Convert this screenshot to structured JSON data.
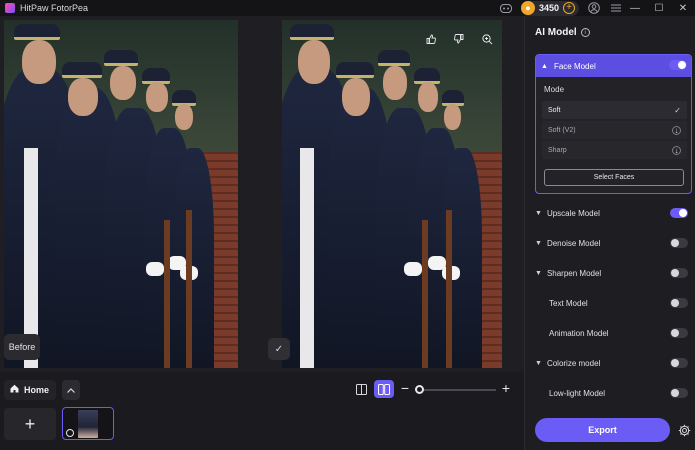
{
  "app": {
    "title": "HitPaw FotorPea",
    "coins": "3450"
  },
  "titlebar": {
    "discord_icon": "game-controller-icon",
    "coin_icon": "coin-icon",
    "plus_icon": "plus-icon",
    "account_icon": "user-circle-icon",
    "menu_icon": "hamburger-icon",
    "minimize": "—",
    "maximize": "☐",
    "close": "✕"
  },
  "canvas": {
    "before_label": "Before",
    "overlay_icons": [
      "thumbs-up-icon",
      "thumbs-down-icon",
      "zoom-in-icon",
      "crop-icon"
    ],
    "check_icon": "✓"
  },
  "bottom": {
    "home_label": "Home",
    "collapse_icon": "^",
    "add_icon": "+",
    "zoom_minus": "−",
    "zoom_plus": "+",
    "zoom_level": 0.0
  },
  "panel": {
    "title": "AI Model",
    "face_model": {
      "label": "Face Model",
      "enabled": true,
      "mode_label": "Mode",
      "modes": [
        {
          "label": "Soft",
          "selected": true
        },
        {
          "label": "Soft (V2)",
          "selected": false
        },
        {
          "label": "Sharp",
          "selected": false
        }
      ],
      "select_faces_label": "Select Faces"
    },
    "models": [
      {
        "label": "Upscale Model",
        "enabled": true,
        "caret": true
      },
      {
        "label": "Denoise Model",
        "enabled": false,
        "caret": true
      },
      {
        "label": "Sharpen Model",
        "enabled": false,
        "caret": true
      },
      {
        "label": "Text Model",
        "enabled": false,
        "caret": false
      },
      {
        "label": "Animation Model",
        "enabled": false,
        "caret": false
      },
      {
        "label": "Colorize model",
        "enabled": false,
        "caret": true
      },
      {
        "label": "Low-light Model",
        "enabled": false,
        "caret": false
      }
    ],
    "export_label": "Export"
  },
  "colors": {
    "accent": "#6a5cf5",
    "coin": "#f0a72a",
    "background": "#1b1b1f"
  }
}
